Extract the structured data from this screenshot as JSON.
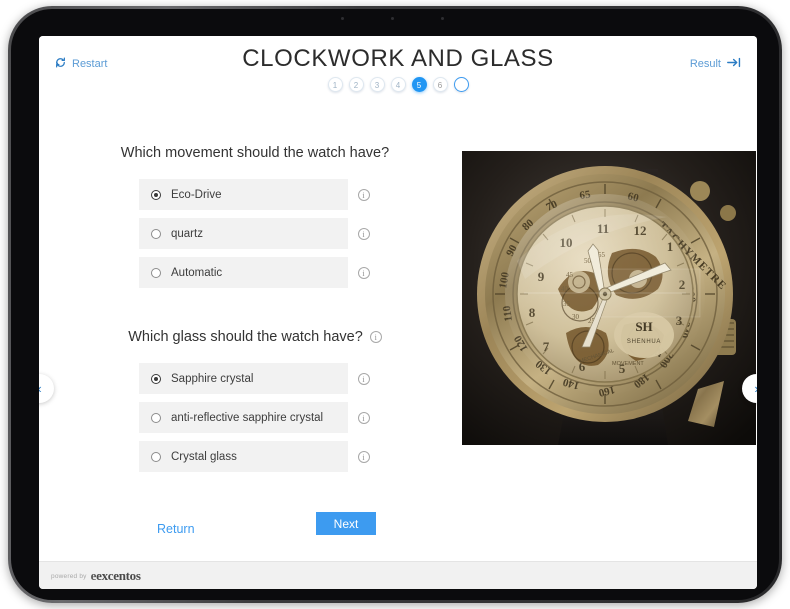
{
  "app": {
    "title": "CLOCKWORK AND GLASS",
    "restart_label": "Restart",
    "restart_icon": "refresh-icon",
    "result_label": "Result",
    "result_icon": "arrow-to-line-icon"
  },
  "steps": [
    {
      "label": "1",
      "state": "done"
    },
    {
      "label": "2",
      "state": "done"
    },
    {
      "label": "3",
      "state": "done"
    },
    {
      "label": "4",
      "state": "done"
    },
    {
      "label": "5",
      "state": "active"
    },
    {
      "label": "6",
      "state": "upcoming"
    },
    {
      "label": "",
      "state": "empty"
    }
  ],
  "questions": [
    {
      "title": "Which movement should the watch have?",
      "has_title_info": false,
      "options": [
        {
          "label": "Eco-Drive",
          "selected": true,
          "info_icon": "info-icon"
        },
        {
          "label": "quartz",
          "selected": false,
          "info_icon": "info-icon"
        },
        {
          "label": "Automatic",
          "selected": false,
          "info_icon": "info-icon"
        }
      ]
    },
    {
      "title": "Which glass should the watch have?",
      "has_title_info": true,
      "title_info_icon": "info-icon",
      "options": [
        {
          "label": "Sapphire crystal",
          "selected": true,
          "info_icon": "info-icon"
        },
        {
          "label": "anti-reflective sapphire crystal",
          "selected": false,
          "info_icon": "info-icon"
        },
        {
          "label": "Crystal glass",
          "selected": false,
          "info_icon": "info-icon"
        }
      ]
    }
  ],
  "actions": {
    "return_label": "Return",
    "next_label": "Next"
  },
  "navigation": {
    "prev_icon": "chevron-left-icon",
    "prev_glyph": "‹",
    "next_icon": "chevron-right-icon",
    "next_glyph": "›"
  },
  "product_image": {
    "alt": "Bronze skeleton mechanical wristwatch with tachymetre bezel and black leather strap",
    "brand_text": "SHENHUA",
    "bezel_text": "TACHYMETRE"
  },
  "footer": {
    "powered_by": "powered by",
    "brand": "excentos",
    "brand_mark": "e"
  },
  "colors": {
    "accent": "#3d9bf0",
    "accent_active": "#2196f3",
    "option_bg": "#f2f2f2",
    "title_text": "#2c2c2c",
    "footer_bg": "#f1f1f1"
  }
}
